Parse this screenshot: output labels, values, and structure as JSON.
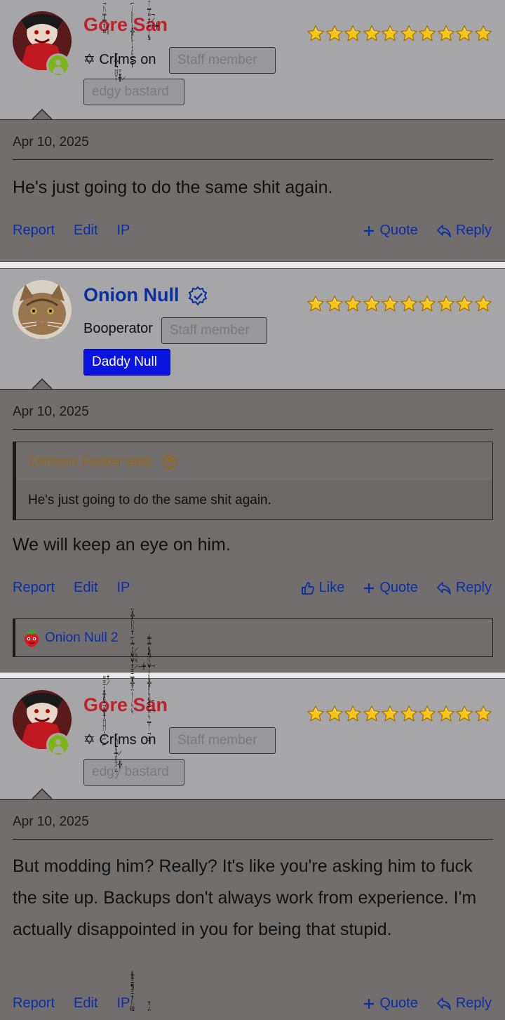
{
  "posts": [
    {
      "username": "Gore San",
      "user_title": "Cr[ms on",
      "user_title_prefix": "✡",
      "staff_badge": "Staff member",
      "banner": "edgy bastard",
      "date": "Apr 10, 2025",
      "content": "He's just going to do the same shit again.",
      "actions_left": [
        "Report",
        "Edit",
        "IP"
      ],
      "actions_right": [
        "Quote",
        "Reply"
      ],
      "name_color": "#c0202d"
    },
    {
      "username": "Onion Null",
      "user_title": "Booperator",
      "staff_badge": "Staff member",
      "banner": "Daddy Null",
      "date": "Apr 10, 2025",
      "quote_author": "Crimson Fucker said:",
      "quote_text": "He's just going to do the same shit again.",
      "content": "We will keep an eye on him.",
      "actions_left": [
        "Report",
        "Edit",
        "IP"
      ],
      "actions_right": [
        "Like",
        "Quote",
        "Reply"
      ],
      "reaction_user": "Onion Null 2",
      "name_color": "#0a2f9e"
    },
    {
      "username": "Gore San",
      "user_title": "Cr[ms on",
      "user_title_prefix": "✡",
      "staff_badge": "Staff member",
      "banner": "edgy bastard",
      "date": "Apr 10, 2025",
      "content": "But modding him? Really? It's like you're asking him to fuck the site up. Backups don't always work from experience. I'm actually disappointed in you for being that stupid.",
      "actions_left": [
        "Report",
        "Edit",
        "IP"
      ],
      "actions_right": [
        "Quote",
        "Reply"
      ],
      "name_color": "#c0202d"
    }
  ],
  "icons": {
    "star": "star-icon",
    "online": "online-user-icon",
    "verified": "verified-badge-icon",
    "quote": "plus-icon",
    "reply": "reply-icon",
    "like": "thumbs-up-icon",
    "quote_jump": "arrow-up-circle-icon",
    "reaction": "strawberry-icon"
  },
  "colors": {
    "user_area_bg": "#a6a6a8",
    "post_bg": "#726e6e",
    "link": "#0a2fa6",
    "star": "#f5c518",
    "online": "#7cb518",
    "daddy_banner": "#0a14e0"
  }
}
